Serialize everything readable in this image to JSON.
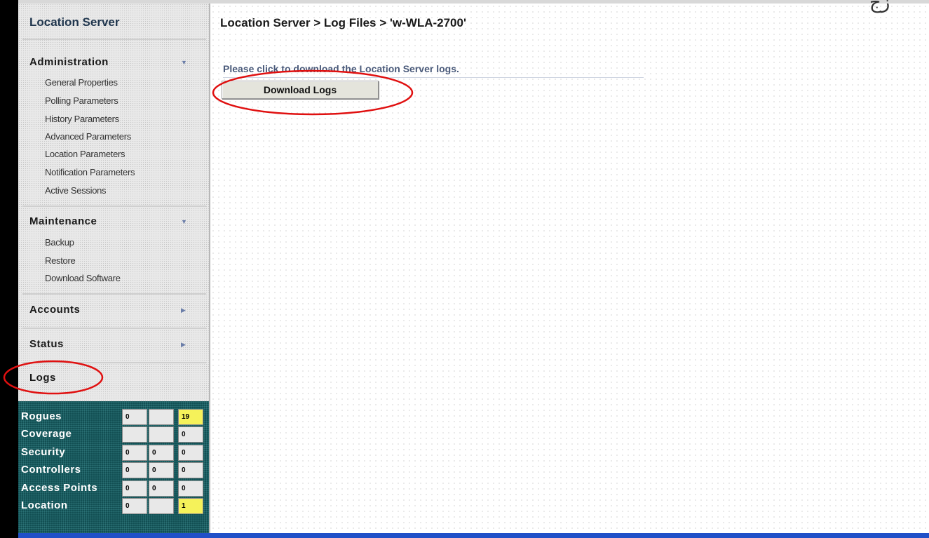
{
  "sidebar": {
    "title": "Location Server",
    "sections": [
      {
        "label": "Administration",
        "items": [
          "General Properties",
          "Polling Parameters",
          "History Parameters",
          "Advanced Parameters",
          "Location Parameters",
          "Notification Parameters",
          "Active Sessions"
        ]
      },
      {
        "label": "Maintenance",
        "items": [
          "Backup",
          "Restore",
          "Download Software"
        ]
      },
      {
        "label": "Accounts"
      },
      {
        "label": "Status"
      },
      {
        "label": "Logs"
      }
    ]
  },
  "stats": {
    "rows": [
      {
        "label": "Rogues",
        "values": [
          "0",
          "",
          "19"
        ],
        "highlight": [
          false,
          false,
          true
        ]
      },
      {
        "label": "Coverage",
        "values": [
          "",
          "",
          "0"
        ],
        "highlight": [
          false,
          false,
          false
        ]
      },
      {
        "label": "Security",
        "values": [
          "0",
          "0",
          "0"
        ],
        "highlight": [
          false,
          false,
          false
        ]
      },
      {
        "label": "Controllers",
        "values": [
          "0",
          "0",
          "0"
        ],
        "highlight": [
          false,
          false,
          false
        ]
      },
      {
        "label": "Access Points",
        "values": [
          "0",
          "0",
          "0"
        ],
        "highlight": [
          false,
          false,
          false
        ]
      },
      {
        "label": "Location",
        "values": [
          "0",
          "",
          "1"
        ],
        "highlight": [
          false,
          false,
          true
        ]
      }
    ]
  },
  "main": {
    "breadcrumb": "Location Server > Log Files > 'w-WLA-2700'",
    "prompt": "Please click to download the Location Server logs.",
    "download_button": "Download Logs"
  },
  "icons": {
    "expanded_arrow": "triangle-down-icon",
    "collapsed_arrow": "triangle-right-icon"
  },
  "colors": {
    "stats_background": "#124f53",
    "highlight_cell": "#f5f25a",
    "annotation": "#e01010",
    "bottom_bar": "#2050c8"
  }
}
